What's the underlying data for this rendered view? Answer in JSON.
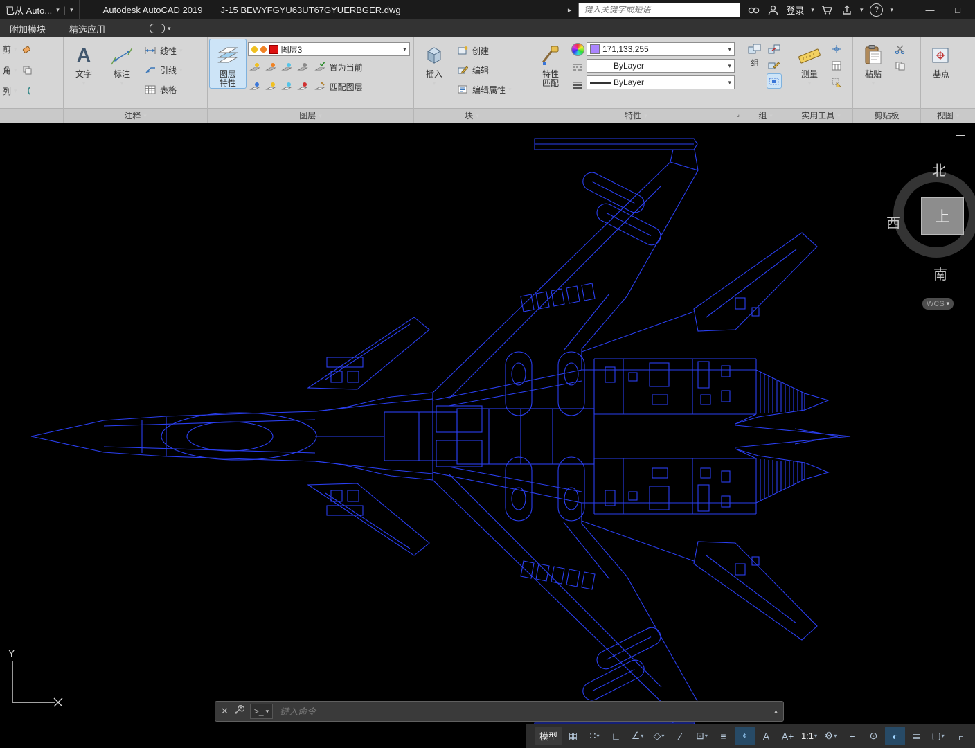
{
  "titlebar": {
    "quick_access": "已从 Auto...",
    "app_title": "Autodesk AutoCAD 2019",
    "doc_title": "J-15 BEWYFGYU63UT67GYUERBGER.dwg",
    "search_placeholder": "键入关键字或短语",
    "login": "登录"
  },
  "glyphs": {
    "caret": "▾",
    "caret_up": "▴",
    "chevron": "▸",
    "minimize": "—",
    "maximize": "□",
    "close": "✕",
    "vdiv": "|",
    "corner": "⌟",
    "prompt": "&gt;_"
  },
  "tabs": {
    "addons": "附加模块",
    "featured": "精选应用"
  },
  "left_panel": {
    "row1": "剪",
    "row2": "角",
    "row3": "列"
  },
  "ribbon": {
    "annotation": {
      "caption": "注释",
      "text": "文字",
      "dimension": "标注",
      "linear": "线性",
      "leader": "引线",
      "table": "表格"
    },
    "layers": {
      "caption": "图层",
      "big_line1": "图层",
      "big_line2": "特性",
      "current_layer": "图层3",
      "set_current": "置为当前",
      "match": "匹配图层"
    },
    "block": {
      "caption": "块",
      "insert": "插入",
      "create": "创建",
      "edit": "编辑",
      "edit_attr": "编辑属性"
    },
    "properties": {
      "caption": "特性",
      "big_line1": "特性",
      "big_line2": "匹配",
      "color": "171,133,255",
      "color_hex": "#ab85ff",
      "linetype": "ByLayer",
      "lineweight": "ByLayer"
    },
    "group": {
      "caption": "组",
      "label": "组"
    },
    "utilities": {
      "caption": "实用工具",
      "measure": "测量"
    },
    "clipboard": {
      "caption": "剪贴板",
      "paste": "粘贴"
    },
    "view": {
      "caption": "视图",
      "base": "基点"
    }
  },
  "viewcube": {
    "north": "北",
    "west": "西",
    "south": "南",
    "top": "上",
    "wcs": "WCS"
  },
  "ucs": {
    "x": "X",
    "y": "Y"
  },
  "command": {
    "prompt": ">_",
    "placeholder": "键入命令"
  },
  "status": {
    "model": "模型",
    "scale": "1:1",
    "icons": {
      "grid": "▦",
      "snap": "∷",
      "ortho": "∟",
      "polar": "∠",
      "isodraft": "◇",
      "otrack": "∕",
      "osnap": "⊡",
      "lineweight": "≡",
      "cycling": "⌖",
      "annot": "A",
      "autoscale": "A+",
      "gear": "⚙",
      "plus": "+",
      "isolate": "⊙",
      "perf": "◐",
      "plot": "▤",
      "uilock": "▢",
      "clean": "◲"
    }
  },
  "drawing": {
    "primary": "#2a3ff0",
    "bright": "#5468ff",
    "subject": "J-15 fighter top view wireframe"
  }
}
